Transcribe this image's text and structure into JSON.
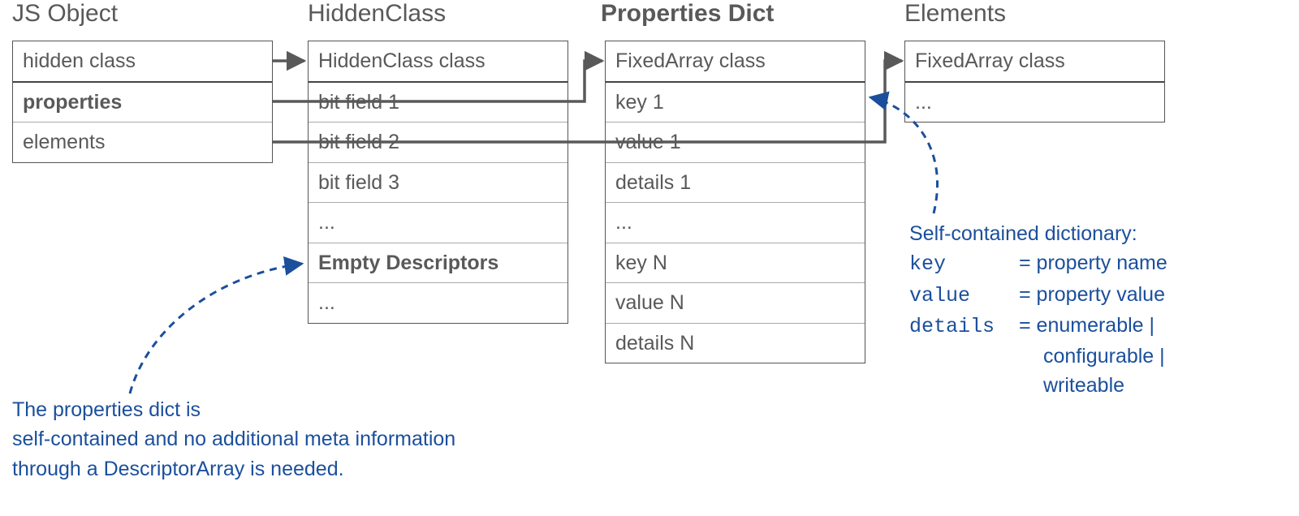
{
  "titles": {
    "jsobject": "JS Object",
    "hiddenclass": "HiddenClass",
    "propdict": "Properties Dict",
    "elements": "Elements"
  },
  "jsobject_cells": {
    "hidden_class": "hidden class",
    "properties": "properties",
    "elements": "elements"
  },
  "hiddenclass_cells": {
    "header": "HiddenClass class",
    "bit1": "bit field 1",
    "bit2": "bit field 2",
    "bit3": "bit field 3",
    "dots1": "...",
    "empty_desc": "Empty Descriptors",
    "dots2": "..."
  },
  "propdict_cells": {
    "header": "FixedArray class",
    "k1": "key 1",
    "v1": "value 1",
    "d1": "details 1",
    "dots": "...",
    "kN": "key N",
    "vN": "value N",
    "dN": "details N"
  },
  "elements_cells": {
    "header": "FixedArray class",
    "dots": "..."
  },
  "annot_left": {
    "l1": "The properties dict is",
    "l2": "self-contained and no additional meta information",
    "l3": "through a DescriptorArray is needed."
  },
  "annot_right": {
    "l0": "Self-contained dictionary:",
    "l1a": "key",
    "l1b": "= property name",
    "l2a": "value",
    "l2b": "= property value",
    "l3a": "details",
    "l3b": "= enumerable   |",
    "l4": "configurable |",
    "l5": "writeable"
  }
}
